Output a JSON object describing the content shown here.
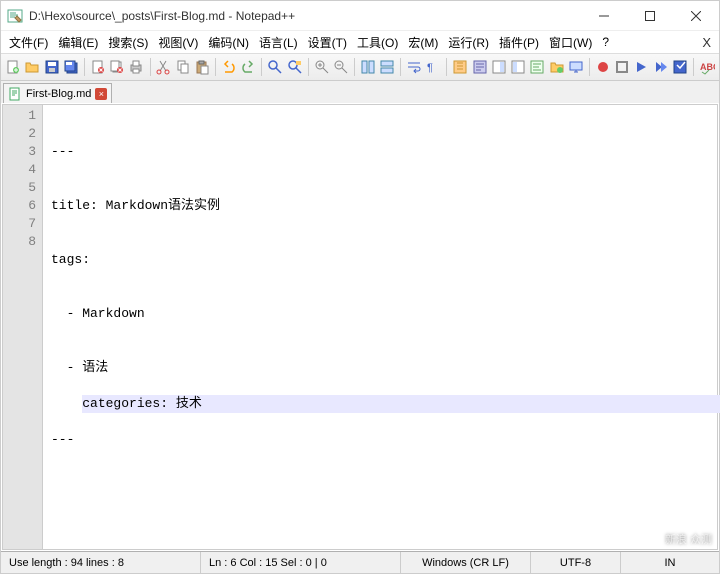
{
  "title": "D:\\Hexo\\source\\_posts\\First-Blog.md - Notepad++",
  "menus": [
    "文件(F)",
    "编辑(E)",
    "搜索(S)",
    "视图(V)",
    "编码(N)",
    "语言(L)",
    "设置(T)",
    "工具(O)",
    "宏(M)",
    "运行(R)",
    "插件(P)",
    "窗口(W)",
    "?"
  ],
  "tab": {
    "name": "First-Blog.md"
  },
  "lines": {
    "l1": "---",
    "l2": "title: Markdown语法实例",
    "l3": "tags:",
    "l4": "  - Markdown",
    "l5": "  - 语法",
    "l6": "categories: 技术",
    "l7": "---",
    "l8": ""
  },
  "gutter": {
    "n1": "1",
    "n2": "2",
    "n3": "3",
    "n4": "4",
    "n5": "5",
    "n6": "6",
    "n7": "7",
    "n8": "8"
  },
  "status": {
    "left": "Use length : 94    lines : 8",
    "pos": "Ln : 6    Col : 15    Sel : 0 | 0",
    "eol": "Windows (CR LF)",
    "enc": "UTF-8",
    "mode": "IN"
  },
  "watermark": "新浪 众测"
}
